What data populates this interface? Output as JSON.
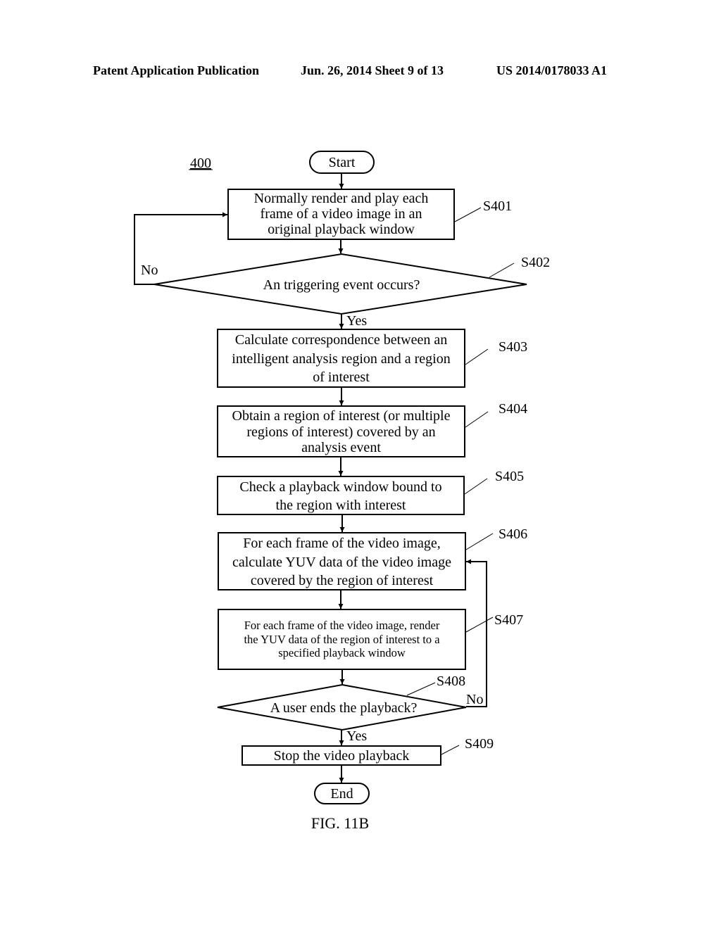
{
  "header": {
    "publication": "Patent Application Publication",
    "date_sheet": "Jun. 26, 2014  Sheet 9 of 13",
    "number": "US 2014/0178033 A1"
  },
  "figure": {
    "ref": "400",
    "caption": "FIG. 11B",
    "start": "Start",
    "end": "End",
    "yes": "Yes",
    "no": "No",
    "steps": {
      "s401": {
        "id": "S401",
        "lines": [
          "Normally render and play each",
          "frame of a video image in an",
          "original playback window"
        ]
      },
      "s402": {
        "id": "S402",
        "lines": [
          "An triggering event occurs?"
        ]
      },
      "s403": {
        "id": "S403",
        "lines": [
          "Calculate correspondence between an",
          "intelligent analysis region and a region",
          "of interest"
        ]
      },
      "s404": {
        "id": "S404",
        "lines": [
          "Obtain a region of interest (or multiple",
          "regions of interest) covered by an",
          "analysis event"
        ]
      },
      "s405": {
        "id": "S405",
        "lines": [
          "Check a playback window bound to",
          "the region with interest"
        ]
      },
      "s406": {
        "id": "S406",
        "lines": [
          "For each frame of the video image,",
          "calculate YUV data of the video image",
          "covered by the region of interest"
        ]
      },
      "s407": {
        "id": "S407",
        "lines": [
          "For each frame of the video image, render",
          "the YUV data of the region of interest to a",
          "specified playback window"
        ]
      },
      "s408": {
        "id": "S408",
        "lines": [
          "A user ends the playback?"
        ]
      },
      "s409": {
        "id": "S409",
        "lines": [
          "Stop the video playback"
        ]
      }
    }
  }
}
